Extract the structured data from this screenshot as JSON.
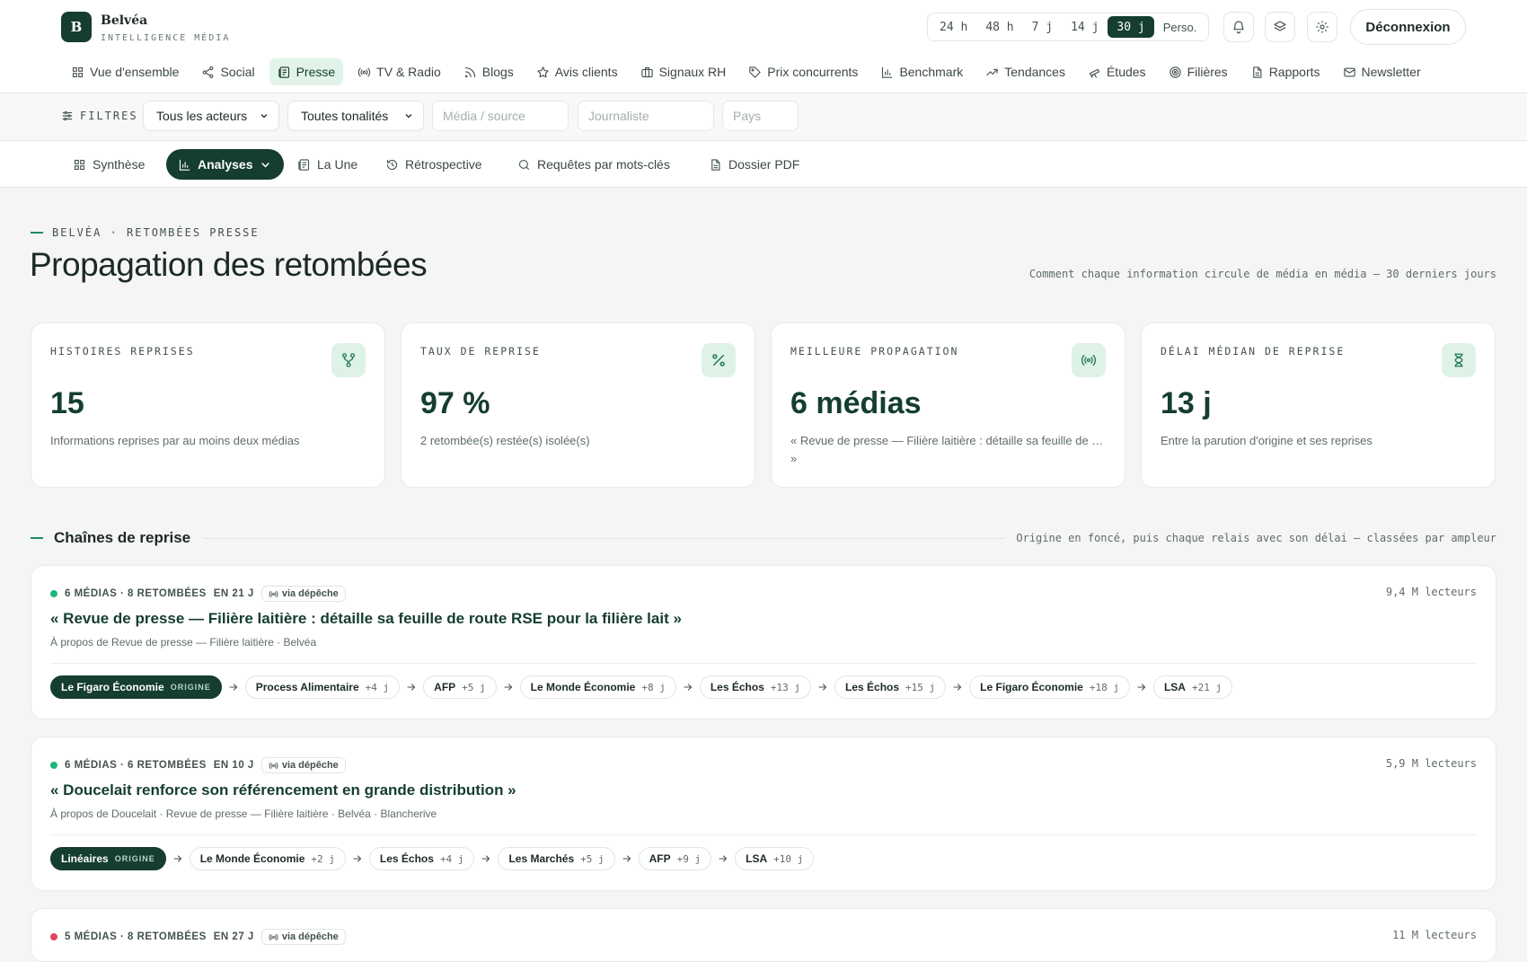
{
  "brand": {
    "logo_letter": "B",
    "name": "Belvéa",
    "tagline": "INTELLIGENCE MÉDIA"
  },
  "periods": [
    "24 h",
    "48 h",
    "7 j",
    "14 j",
    "30 j",
    "Perso."
  ],
  "active_period": "30 j",
  "header_icons": [
    "bell-icon",
    "layers-icon",
    "gear-icon"
  ],
  "logout_label": "Déconnexion",
  "main_nav": [
    {
      "label": "Vue d'ensemble",
      "icon": "grid-icon"
    },
    {
      "label": "Social",
      "icon": "share-icon"
    },
    {
      "label": "Presse",
      "icon": "newspaper-icon",
      "active": true
    },
    {
      "label": "TV & Radio",
      "icon": "broadcast-icon"
    },
    {
      "label": "Blogs",
      "icon": "rss-icon"
    },
    {
      "label": "Avis clients",
      "icon": "star-icon"
    },
    {
      "label": "Signaux RH",
      "icon": "briefcase-icon"
    },
    {
      "label": "Prix concurrents",
      "icon": "tag-icon"
    },
    {
      "label": "Benchmark",
      "icon": "bar-chart-icon"
    },
    {
      "label": "Tendances",
      "icon": "trend-icon"
    },
    {
      "label": "Études",
      "icon": "telescope-icon"
    },
    {
      "label": "Filières",
      "icon": "target-icon"
    },
    {
      "label": "Rapports",
      "icon": "document-icon"
    },
    {
      "label": "Newsletter",
      "icon": "mail-icon"
    }
  ],
  "filters": {
    "label": "FILTRES",
    "actors": "Tous les acteurs",
    "tone": "Toutes tonalités",
    "media_placeholder": "Média / source",
    "journalist_placeholder": "Journaliste",
    "country_placeholder": "Pays"
  },
  "sub_nav": [
    {
      "label": "Synthèse",
      "icon": "grid-icon"
    },
    {
      "label": "Analyses",
      "icon": "bar-chart-icon",
      "active": true
    },
    {
      "label": "La Une",
      "icon": "newspaper-icon"
    },
    {
      "label": "Rétrospective",
      "icon": "history-icon"
    },
    {
      "label": "Requêtes par mots-clés",
      "icon": "search-icon"
    },
    {
      "label": "Dossier PDF",
      "icon": "document-icon"
    }
  ],
  "page": {
    "eyebrow": "BELVÉA · RETOMBÉES PRESSE",
    "title": "Propagation des retombées",
    "subtitle": "Comment chaque information circule de média en média — 30 derniers jours"
  },
  "kpis": [
    {
      "label": "HISTOIRES REPRISES",
      "value": "15",
      "desc": "Informations reprises par au moins deux médias",
      "icon": "branch-icon"
    },
    {
      "label": "TAUX DE REPRISE",
      "value": "97 %",
      "desc": "2 retombée(s) restée(s) isolée(s)",
      "icon": "percent-icon"
    },
    {
      "label": "MEILLEURE PROPAGATION",
      "value": "6 médias",
      "desc": "« Revue de presse — Filière laitière : détaille sa feuille de … »",
      "icon": "broadcast-icon"
    },
    {
      "label": "DÉLAI MÉDIAN DE REPRISE",
      "value": "13 j",
      "desc": "Entre la parution d'origine et ses reprises",
      "icon": "hourglass-icon"
    }
  ],
  "section": {
    "title": "Chaînes de reprise",
    "note": "Origine en foncé, puis chaque relais avec son délai — classées par ampleur"
  },
  "colors": {
    "accent": "#153d31",
    "positive": "#1fb67a",
    "negative": "#e0445a"
  },
  "chains": [
    {
      "meta": "6 MÉDIAS · 8 RETOMBÉES",
      "span": "EN 21 J",
      "depeche": "via dépêche",
      "status_color": "#1fb67a",
      "readers": "9,4 M lecteurs",
      "title": "« Revue de presse — Filière laitière : détaille sa feuille de route RSE pour la filière lait »",
      "about": "À propos de Revue de presse — Filière laitière · Belvéa",
      "origin": "Le Figaro Économie",
      "origin_tag": "ORIGINE",
      "relays": [
        {
          "media": "Process Alimentaire",
          "delay": "+4 j"
        },
        {
          "media": "AFP",
          "delay": "+5 j"
        },
        {
          "media": "Le Monde Économie",
          "delay": "+8 j"
        },
        {
          "media": "Les Échos",
          "delay": "+13 j"
        },
        {
          "media": "Les Échos",
          "delay": "+15 j"
        },
        {
          "media": "Le Figaro Économie",
          "delay": "+18 j"
        },
        {
          "media": "LSA",
          "delay": "+21 j"
        }
      ]
    },
    {
      "meta": "6 MÉDIAS · 6 RETOMBÉES",
      "span": "EN 10 J",
      "depeche": "via dépêche",
      "status_color": "#1fb67a",
      "readers": "5,9 M lecteurs",
      "title": "« Doucelait renforce son référencement en grande distribution »",
      "about": "À propos de Doucelait · Revue de presse — Filière laitière · Belvéa · Blancherive",
      "origin": "Linéaires",
      "origin_tag": "ORIGINE",
      "relays": [
        {
          "media": "Le Monde Économie",
          "delay": "+2 j"
        },
        {
          "media": "Les Échos",
          "delay": "+4 j"
        },
        {
          "media": "Les Marchés",
          "delay": "+5 j"
        },
        {
          "media": "AFP",
          "delay": "+9 j"
        },
        {
          "media": "LSA",
          "delay": "+10 j"
        }
      ]
    },
    {
      "meta": "5 MÉDIAS · 8 RETOMBÉES",
      "span": "EN 27 J",
      "depeche": "via dépêche",
      "status_color": "#e0445a",
      "readers": "11 M lecteurs"
    }
  ]
}
